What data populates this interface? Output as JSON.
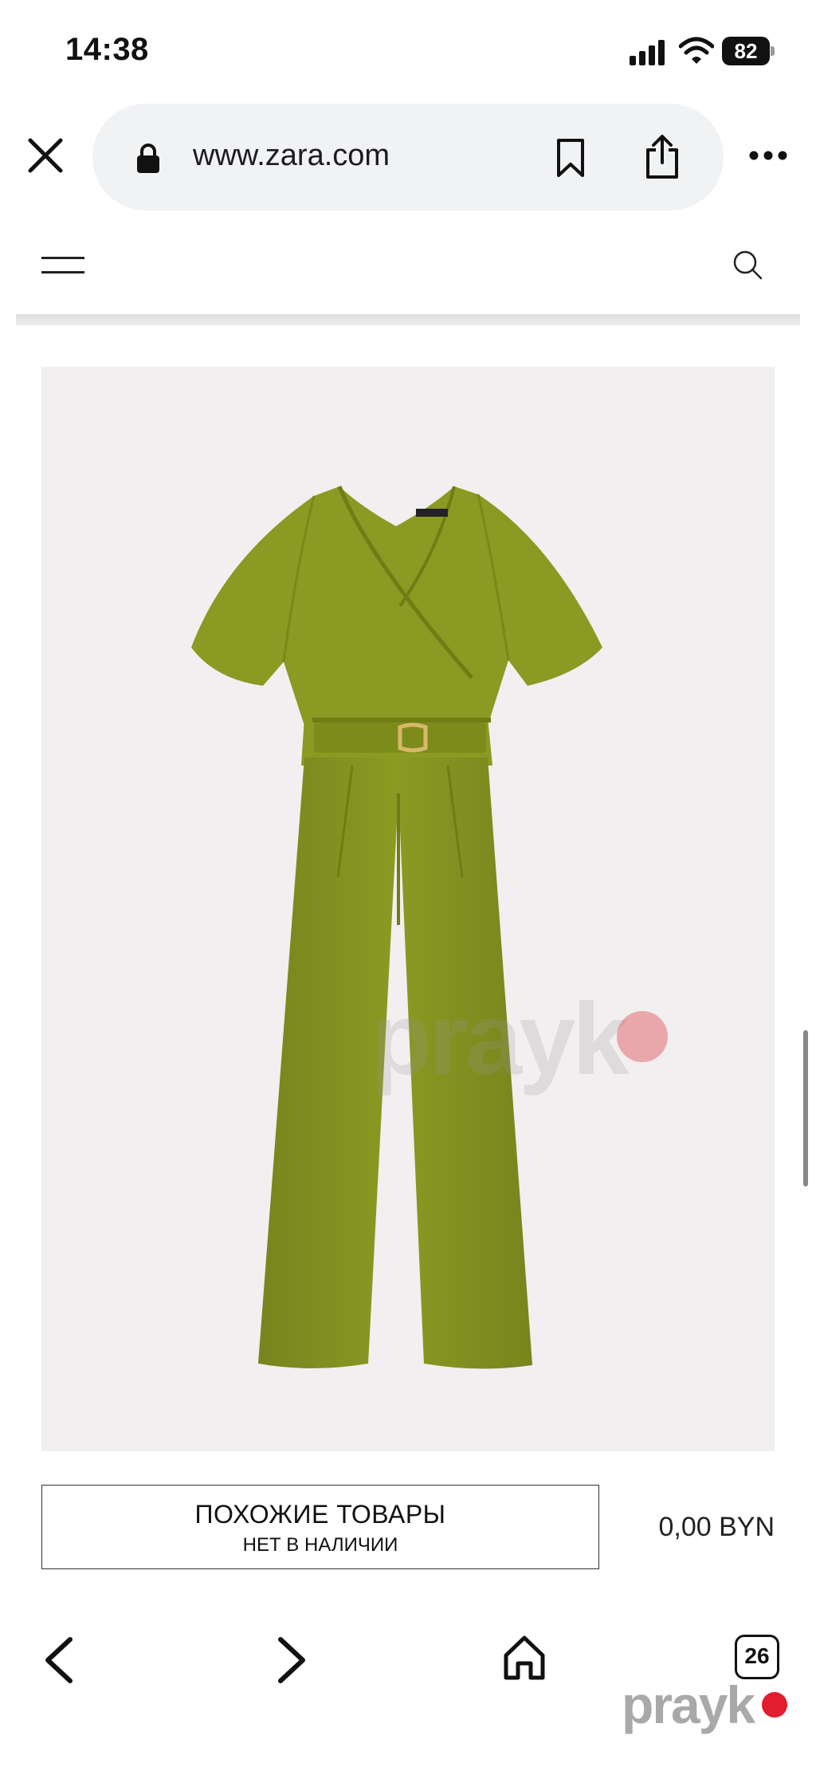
{
  "status_bar": {
    "time": "14:38",
    "battery": "82"
  },
  "browser": {
    "url": "www.zara.com",
    "tab_count": "26"
  },
  "product": {
    "similar_button": {
      "title": "ПОХОЖИЕ ТОВАРЫ",
      "subtitle": "НЕТ В НАЛИЧИИ"
    },
    "price": "0,00 BYN",
    "image_watermark": "prayk",
    "garment_color": "#8a9a22"
  },
  "footer": {
    "logo": "prayk"
  },
  "icons": [
    "close-icon",
    "lock-icon",
    "bookmark-icon",
    "share-icon",
    "more-icon",
    "menu-icon",
    "search-icon",
    "back-icon",
    "forward-icon",
    "home-icon"
  ],
  "colors": {
    "url_bar_bg": "#f1f2f4",
    "image_bg": "#f1efef",
    "logo_dot": "#e11d2e"
  }
}
